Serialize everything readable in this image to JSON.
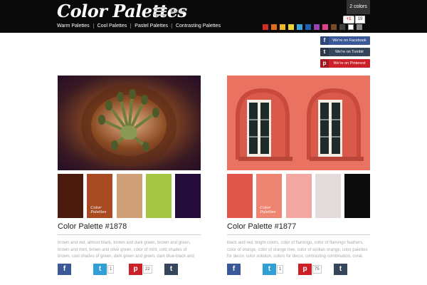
{
  "header": {
    "logo": "Color Palettes",
    "menu_label": "Menu",
    "colors_badge": "2 colors",
    "gplus_label": "+1",
    "gplus_count": "19",
    "nav": [
      "Warm Palettes",
      "Cool Palettes",
      "Pastel Palettes",
      "Contrasting Palettes"
    ],
    "swatch_colors": [
      "#d42a2a",
      "#e06a1f",
      "#f0b62b",
      "#e8d62c",
      "#3aa6d8",
      "#1f5fb5",
      "#9c3fb4",
      "#e43f8f",
      "#7a4a2a",
      "#3f3f3f",
      "#ffffff",
      "#888888"
    ]
  },
  "social": [
    {
      "label": "We're on Facebook",
      "icon": "f",
      "color": "#3b5998"
    },
    {
      "label": "We're on Tumblr",
      "icon": "t",
      "color": "#35465c"
    },
    {
      "label": "We're on Pinterest",
      "icon": "p",
      "color": "#cb2027"
    }
  ],
  "cards": [
    {
      "title": "Color Palette #1878",
      "palette": [
        "#4a1a0c",
        "#a84a22",
        "#cfa077",
        "#a5c545",
        "#230c3a"
      ],
      "swatch_logo": "Color Palettes",
      "tags": "brown and red, almost black, brown and dark green, brown and green, brown and mint, brown and olive green, color of mint, cold shades of brown, cool shades of green, dark green and green, dark blue-black and light green, dark green, dark green and",
      "facebook_icon": "f",
      "twitter_icon": "t",
      "twitter_count": "1",
      "pinterest_icon": "p",
      "pinterest_count": "22",
      "tumblr_icon": "t"
    },
    {
      "title": "Color Palette #1877",
      "palette": [
        "#e1564a",
        "#ee8472",
        "#f2a7a0",
        "#e3dcda",
        "#0c0c0c"
      ],
      "swatch_logo": "Color Palettes",
      "tags": "black and red, bright colors, color of flamingo, color of flamingo feathers, color of orange, color of orange tree, color of sicilian orange, color palettes for decor, color solution, colors for decor, contrasting combination, coral, coral and pink, monochrome color",
      "facebook_icon": "f",
      "twitter_icon": "t",
      "twitter_count": "1",
      "pinterest_icon": "p",
      "pinterest_count": "75",
      "tumblr_icon": "t"
    }
  ]
}
